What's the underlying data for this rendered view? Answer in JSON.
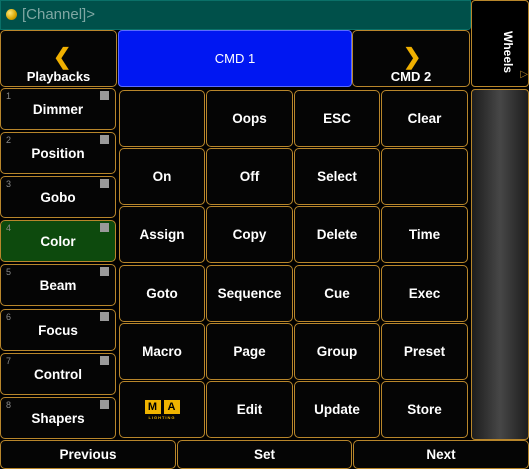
{
  "command_line": {
    "text": "[Channel]>"
  },
  "wheels_tab": {
    "label": "Wheels"
  },
  "playbacks": {
    "label": "Playbacks"
  },
  "cmd1": {
    "label": "CMD 1"
  },
  "cmd2": {
    "label": "CMD 2"
  },
  "presets": [
    {
      "num": "1",
      "label": "Dimmer"
    },
    {
      "num": "2",
      "label": "Position"
    },
    {
      "num": "3",
      "label": "Gobo"
    },
    {
      "num": "4",
      "label": "Color",
      "active": true
    },
    {
      "num": "5",
      "label": "Beam"
    },
    {
      "num": "6",
      "label": "Focus"
    },
    {
      "num": "7",
      "label": "Control"
    },
    {
      "num": "8",
      "label": "Shapers"
    }
  ],
  "keys": {
    "r0": [
      "",
      "Oops",
      "ESC",
      "Clear"
    ],
    "r1": [
      "On",
      "Off",
      "Select",
      ""
    ],
    "r2": [
      "Assign",
      "Copy",
      "Delete",
      "Time"
    ],
    "r3": [
      "Goto",
      "Sequence",
      "Cue",
      "Exec"
    ],
    "r4": [
      "Macro",
      "Page",
      "Group",
      "Preset"
    ],
    "r5": [
      "",
      "Edit",
      "Update",
      "Store"
    ]
  },
  "logo": {
    "letter1": "M",
    "letter2": "A",
    "subtitle": "LIGHTING"
  },
  "bottom": {
    "previous": "Previous",
    "set": "Set",
    "next": "Next"
  },
  "colors": {
    "accent_border": "#b8862b",
    "command_line_bg": "#00504a",
    "cmd1_bg": "#0017f2",
    "active_preset_bg": "#0d4a0d",
    "arrow": "#f0b000"
  }
}
